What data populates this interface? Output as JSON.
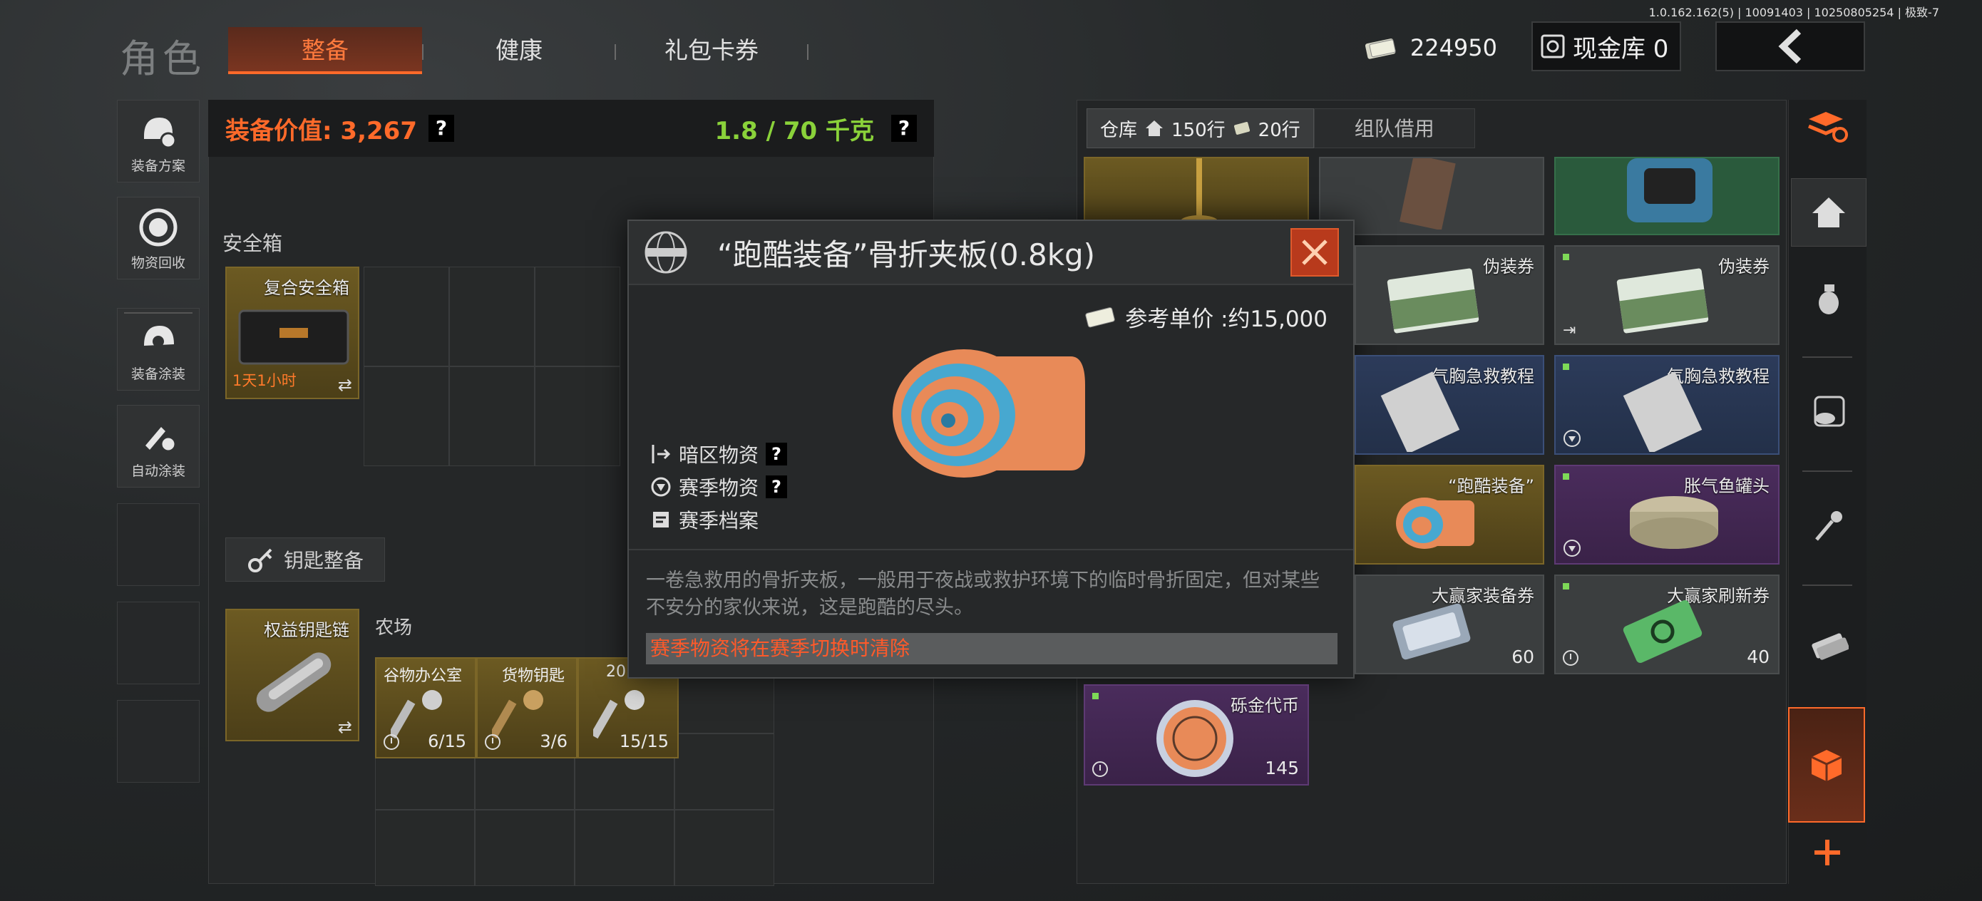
{
  "version": "1.0.162.162(5) | 10091403 | 10250805254 | 极致-7",
  "header": {
    "title": "角色",
    "tabs": [
      {
        "label": "整备",
        "active": true
      },
      {
        "label": "健康",
        "active": false
      },
      {
        "label": "礼包卡券",
        "active": false
      }
    ],
    "currency": "224950",
    "cash_vault": "现金库 0"
  },
  "left_menu": [
    {
      "label": "装备方案",
      "icon": "helmet-gear-icon"
    },
    {
      "label": "物资回收",
      "icon": "recycle-face-icon"
    },
    {
      "label": "装备涂装",
      "icon": "helmet-paint-icon"
    },
    {
      "label": "自动涂装",
      "icon": "brush-gear-icon"
    }
  ],
  "equipment": {
    "value_label": "装备价值: 3,267",
    "weight_label": "1.8 / 70 千克",
    "help": "?"
  },
  "safe_box": {
    "title": "安全箱",
    "item_name": "复合安全箱",
    "timer": "1天1小时"
  },
  "keys": {
    "button_label": "钥匙整备",
    "keychain_name": "权益钥匙链",
    "section_title": "农场",
    "items": [
      {
        "name": "谷物办公室",
        "count": "6/15"
      },
      {
        "name": "货物钥匙",
        "count": "3/6"
      },
      {
        "name": "20",
        "count": "15/15"
      }
    ]
  },
  "storage": {
    "tab_label": "仓库",
    "rows_label": "150行",
    "extra_rows": "20行",
    "team_tab": "组队借用",
    "items": [
      {
        "name": "伪装券",
        "color": "grey"
      },
      {
        "name": "伪装券",
        "color": "grey"
      },
      {
        "name": "气胸急救教程",
        "color": "blue"
      },
      {
        "name": "气胸急救教程",
        "color": "blue"
      },
      {
        "name": "“跑酷装备”",
        "color": "gold"
      },
      {
        "name": "胀气鱼罐头",
        "color": "purple"
      },
      {
        "name": "大赢家装备券",
        "count": "60",
        "color": "grey"
      },
      {
        "name": "大赢家刷新券",
        "count": "40",
        "color": "grey"
      },
      {
        "name": "砾金代币",
        "count": "145",
        "color": "purple"
      }
    ]
  },
  "modal": {
    "title": "“跑酷装备”骨折夹板(0.8kg)",
    "price_label": "参考单价 :约15,000",
    "tags": [
      {
        "label": "暗区物资",
        "help": "?"
      },
      {
        "label": "赛季物资",
        "help": "?"
      },
      {
        "label": "赛季档案",
        "help": ""
      }
    ],
    "description": "一卷急救用的骨折夹板，一般用于夜战或救护环境下的临时骨折固定，但对某些不安分的家伙来说，这是跑酷的尽头。",
    "warning": "赛季物资将在赛季切换时清除"
  },
  "colors": {
    "accent": "#ff6a2a",
    "green": "#8ad23a",
    "warn": "#ff5a2a"
  }
}
